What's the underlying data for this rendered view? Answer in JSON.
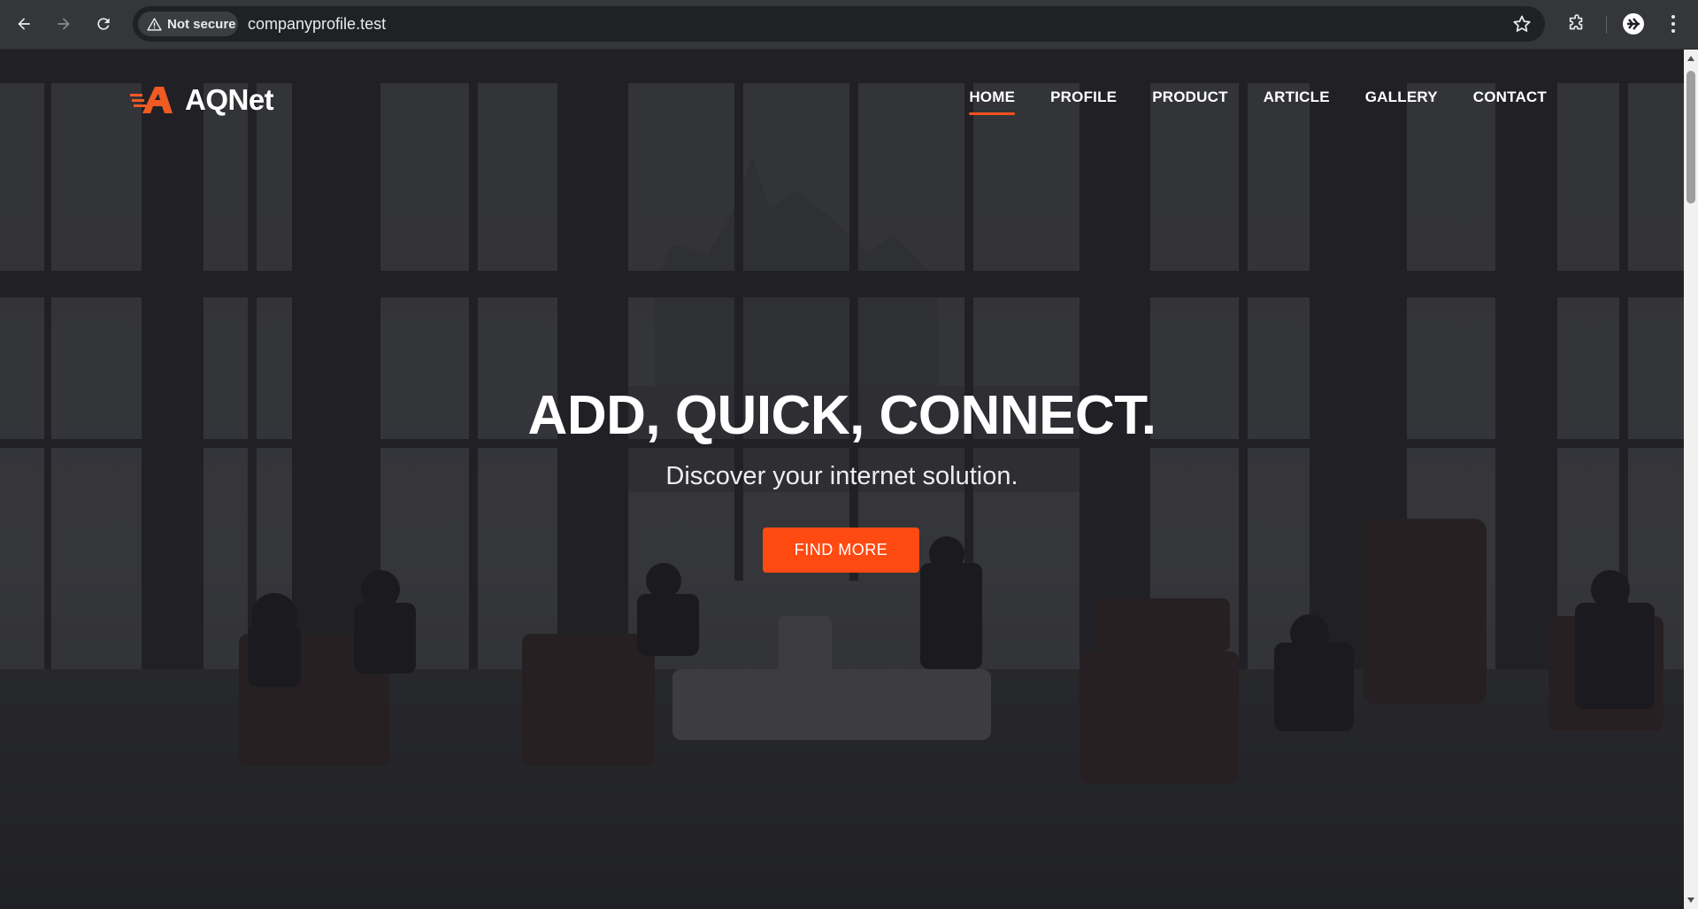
{
  "browser": {
    "security_label": "Not secure",
    "url": "companyprofile.test",
    "icons": {
      "back": "back-arrow-icon",
      "forward": "forward-arrow-icon",
      "reload": "reload-icon",
      "warning": "warning-triangle-icon",
      "bookmark": "star-icon",
      "extensions": "puzzle-icon",
      "profile": "avatar-icon",
      "menu": "kebab-menu-icon"
    }
  },
  "site": {
    "brand": "AQNet",
    "accent_color": "#ff4a12",
    "nav": [
      {
        "label": "HOME",
        "active": true
      },
      {
        "label": "PROFILE",
        "active": false
      },
      {
        "label": "PRODUCT",
        "active": false
      },
      {
        "label": "ARTICLE",
        "active": false
      },
      {
        "label": "GALLERY",
        "active": false
      },
      {
        "label": "CONTACT",
        "active": false
      }
    ],
    "hero": {
      "title": "ADD, QUICK, CONNECT.",
      "subtitle": "Discover your internet solution.",
      "cta_label": "FIND MORE"
    }
  }
}
